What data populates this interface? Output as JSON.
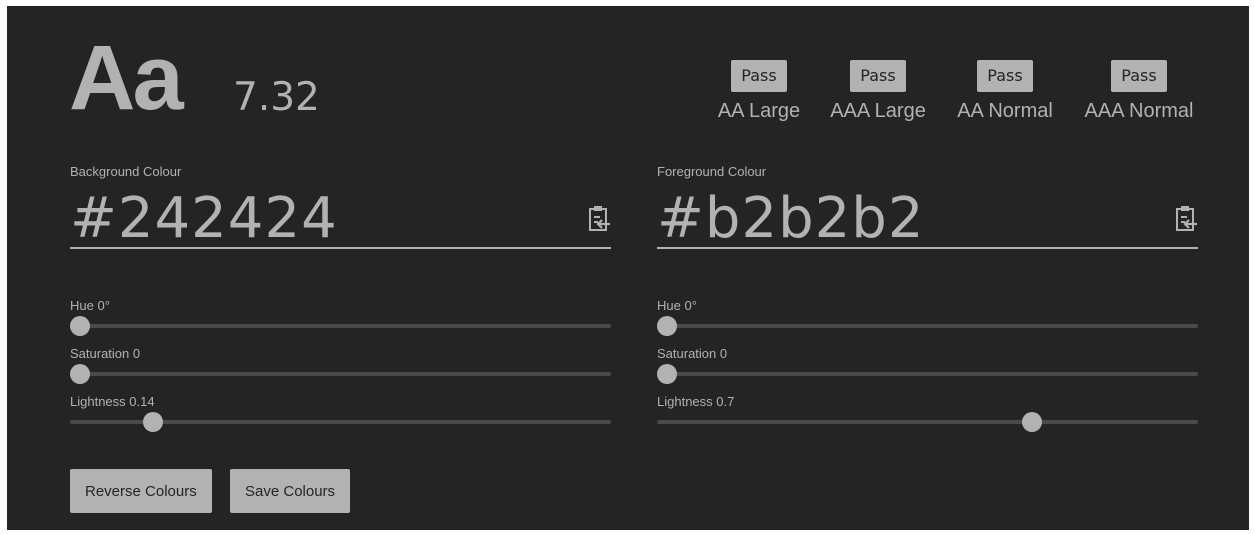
{
  "sample": {
    "text": "Aa",
    "ratio": "7.32"
  },
  "wcag": [
    {
      "badge": "Pass",
      "level": "AA Large"
    },
    {
      "badge": "Pass",
      "level": "AAA Large"
    },
    {
      "badge": "Pass",
      "level": "AA Normal"
    },
    {
      "badge": "Pass",
      "level": "AAA Normal"
    }
  ],
  "background": {
    "label": "Background Colour",
    "hex": "#242424",
    "color": "#242424",
    "hue_label": "Hue 0°",
    "hue": 0,
    "saturation_label": "Saturation 0",
    "saturation": 0,
    "lightness_label": "Lightness 0.14",
    "lightness": 0.14
  },
  "foreground": {
    "label": "Foreground Colour",
    "hex": "#b2b2b2",
    "color": "#b2b2b2",
    "hue_label": "Hue 0°",
    "hue": 0,
    "saturation_label": "Saturation 0",
    "saturation": 0,
    "lightness_label": "Lightness 0.7",
    "lightness": 0.7
  },
  "buttons": {
    "reverse": "Reverse Colours",
    "save": "Save Colours"
  },
  "icons": {
    "clipboard": "clipboard-paste-icon"
  }
}
